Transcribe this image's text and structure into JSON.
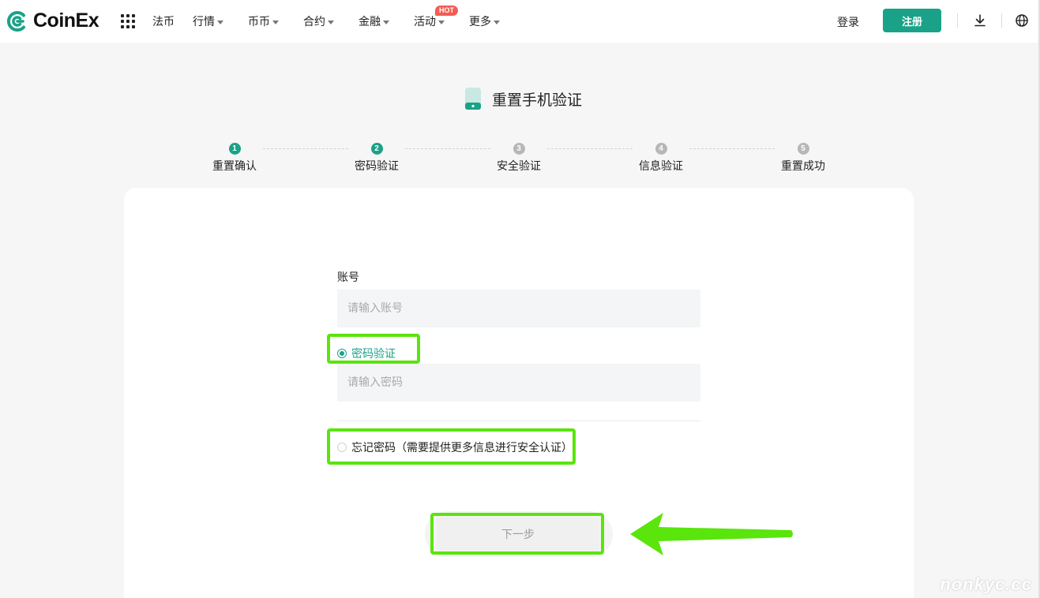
{
  "header": {
    "brand": "CoinEx",
    "nav": [
      {
        "label": "法币",
        "caret": false
      },
      {
        "label": "行情",
        "caret": true
      },
      {
        "label": "币币",
        "caret": true
      },
      {
        "label": "合约",
        "caret": true
      },
      {
        "label": "金融",
        "caret": true
      },
      {
        "label": "活动",
        "caret": true
      },
      {
        "label": "更多",
        "caret": true
      }
    ],
    "hot_badge": "HOT",
    "login": "登录",
    "register": "注册"
  },
  "page": {
    "title": "重置手机验证"
  },
  "steps": [
    {
      "num": "1",
      "label": "重置确认",
      "active": true
    },
    {
      "num": "2",
      "label": "密码验证",
      "active": true
    },
    {
      "num": "3",
      "label": "安全验证",
      "active": false
    },
    {
      "num": "4",
      "label": "信息验证",
      "active": false
    },
    {
      "num": "5",
      "label": "重置成功",
      "active": false
    }
  ],
  "form": {
    "account_label": "账号",
    "account_placeholder": "请输入账号",
    "option_password": "密码验证",
    "password_placeholder": "请输入密码",
    "option_forgot": "忘记密码（需要提供更多信息进行安全认证）",
    "selected_option": "password",
    "next_button": "下一步"
  },
  "watermark": "nonkyc.cc",
  "colors": {
    "brand": "#1aa288",
    "highlight": "#5ae50c",
    "hot": "#f25c54",
    "background": "#f6f6f6"
  }
}
